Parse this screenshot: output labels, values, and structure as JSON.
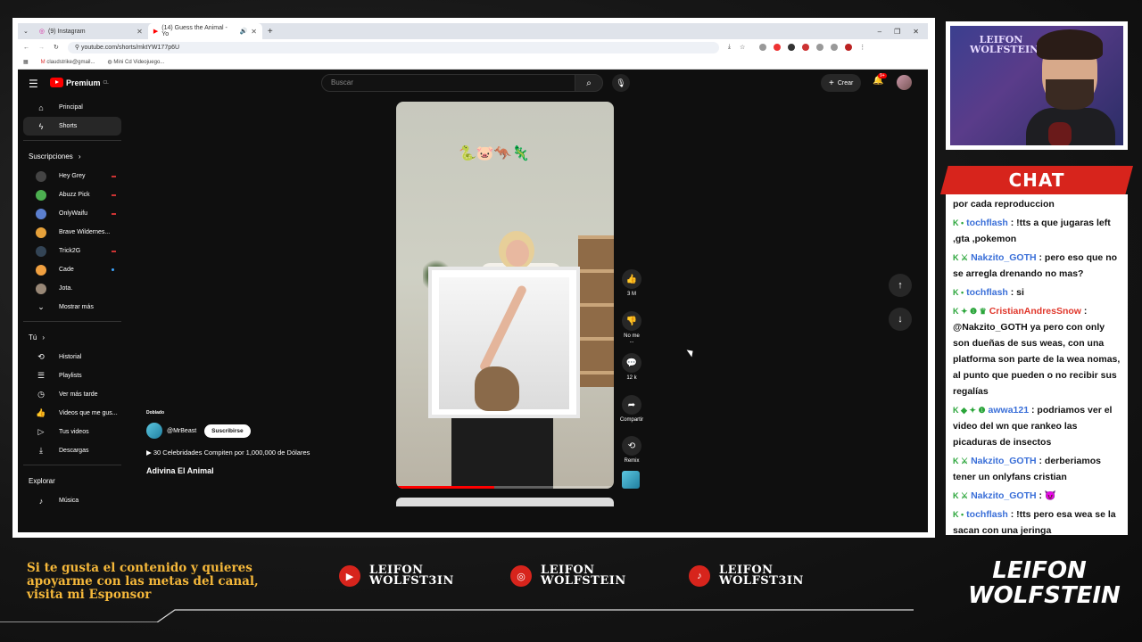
{
  "browser": {
    "tabs": [
      {
        "label": "(9) Instagram",
        "active": false
      },
      {
        "label": "(14) Guess the Animal - Yo",
        "active": true
      }
    ],
    "url": "youtube.com/shorts/mktYW177p6U",
    "bookmarks": [
      "claudstrike@gmail...",
      "Mini Cd Videojuego..."
    ]
  },
  "yt": {
    "logo": "Premium",
    "logo_region": "CL",
    "search_placeholder": "Buscar",
    "create_label": "Crear",
    "notif_badge": "9+",
    "sidebar": {
      "main": [
        {
          "label": "Principal",
          "icon": "home-icon"
        },
        {
          "label": "Shorts",
          "icon": "shorts-icon",
          "active": true
        }
      ],
      "subs_header": "Suscripciones",
      "subs": [
        {
          "label": "Hey Grey",
          "color": "#444444",
          "status": "live"
        },
        {
          "label": "Abuzz Pick",
          "color": "#4caf50",
          "status": "live"
        },
        {
          "label": "OnlyWaifu",
          "color": "#5b7fcf",
          "status": "live"
        },
        {
          "label": "Brave Wildernes...",
          "color": "#e6a13a",
          "status": "live"
        },
        {
          "label": "Trick2G",
          "color": "#334455",
          "status": "live"
        },
        {
          "label": "Cade",
          "color": "#f0a040",
          "status": "new"
        },
        {
          "label": "Jota.",
          "color": "#998877",
          "status": "none"
        }
      ],
      "show_more": "Mostrar más",
      "you_header": "Tú",
      "you": [
        {
          "label": "Historial",
          "icon": "history-icon"
        },
        {
          "label": "Playlists",
          "icon": "playlists-icon"
        },
        {
          "label": "Ver más tarde",
          "icon": "watch-later-icon"
        },
        {
          "label": "Videos que me gus...",
          "icon": "liked-icon"
        },
        {
          "label": "Tus videos",
          "icon": "your-videos-icon"
        },
        {
          "label": "Descargas",
          "icon": "downloads-icon"
        }
      ],
      "explore_header": "Explorar",
      "explore": [
        {
          "label": "Música",
          "icon": "music-icon"
        }
      ]
    },
    "short": {
      "dub_label": "Doblado",
      "channel": "@MrBeast",
      "subscribe": "Suscribirse",
      "playlist": "30 Celebridades Compiten por 1,000,000 de Dólares",
      "title": "Adivina El Animal",
      "progress": 0.45,
      "emoji": "🐍🐷🦘🦎"
    },
    "actions": {
      "like_count": "3 M",
      "dislike_label": "No me ...",
      "comment_count": "12 k",
      "share_label": "Compartir",
      "remix_label": "Remix"
    }
  },
  "webcam": {
    "poster_text": "LEIFON WOLFSTEIN"
  },
  "chat": {
    "title": "CHAT",
    "messages": [
      {
        "badges": "",
        "user": "",
        "color": "#111111",
        "text": "por cada reproduccion"
      },
      {
        "badges": "K •",
        "user": "tochflash",
        "color": "#3a6fd8",
        "text": " : !tts a que jugaras left ,gta ,pokemon"
      },
      {
        "badges": "K ⚔",
        "user": "Nakzito_GOTH",
        "color": "#3a6fd8",
        "text": " : pero eso que no se arregla drenando no mas?"
      },
      {
        "badges": "K •",
        "user": "tochflash",
        "color": "#3a6fd8",
        "text": " : si"
      },
      {
        "badges": "K ✦ ❶ ♛",
        "user": "CristianAndresSnow",
        "color": "#e0372b",
        "text": " : @Nakzito_GOTH ya pero con only son dueñas de sus weas, con una platforma son parte de la wea nomas, al punto que pueden o no recibir sus regalías"
      },
      {
        "badges": "K ◆ ✦ ❶",
        "user": "awwa121",
        "color": "#3a6fd8",
        "text": " : podriamos ver el video del wn que rankeo las picaduras de insectos"
      },
      {
        "badges": "K ⚔",
        "user": "Nakzito_GOTH",
        "color": "#3a6fd8",
        "text": " : derberiamos tener un onlyfans cristian"
      },
      {
        "badges": "K ⚔",
        "user": "Nakzito_GOTH",
        "color": "#3a6fd8",
        "text": " : 😈"
      },
      {
        "badges": "K •",
        "user": "tochflash",
        "color": "#3a6fd8",
        "text": " : !tts pero esa wea se la sacan con una jeringa"
      }
    ]
  },
  "banner": {
    "sponsor_text": "Si te gusta el contenido y quieres apoyarme con las metas del canal, visita mi Esponsor",
    "socials": [
      {
        "platform": "youtube-icon",
        "glyph": "▶",
        "line1": "LEIFON",
        "line2": "WOLFST3IN"
      },
      {
        "platform": "instagram-icon",
        "glyph": "◎",
        "line1": "LEIFON",
        "line2": "WOLFSTEIN"
      },
      {
        "platform": "tiktok-icon",
        "glyph": "♪",
        "line1": "LEIFON",
        "line2": "WOLFST3IN"
      }
    ],
    "logo_line1": "LEIFON",
    "logo_line2": "WOLFSTEIN"
  }
}
